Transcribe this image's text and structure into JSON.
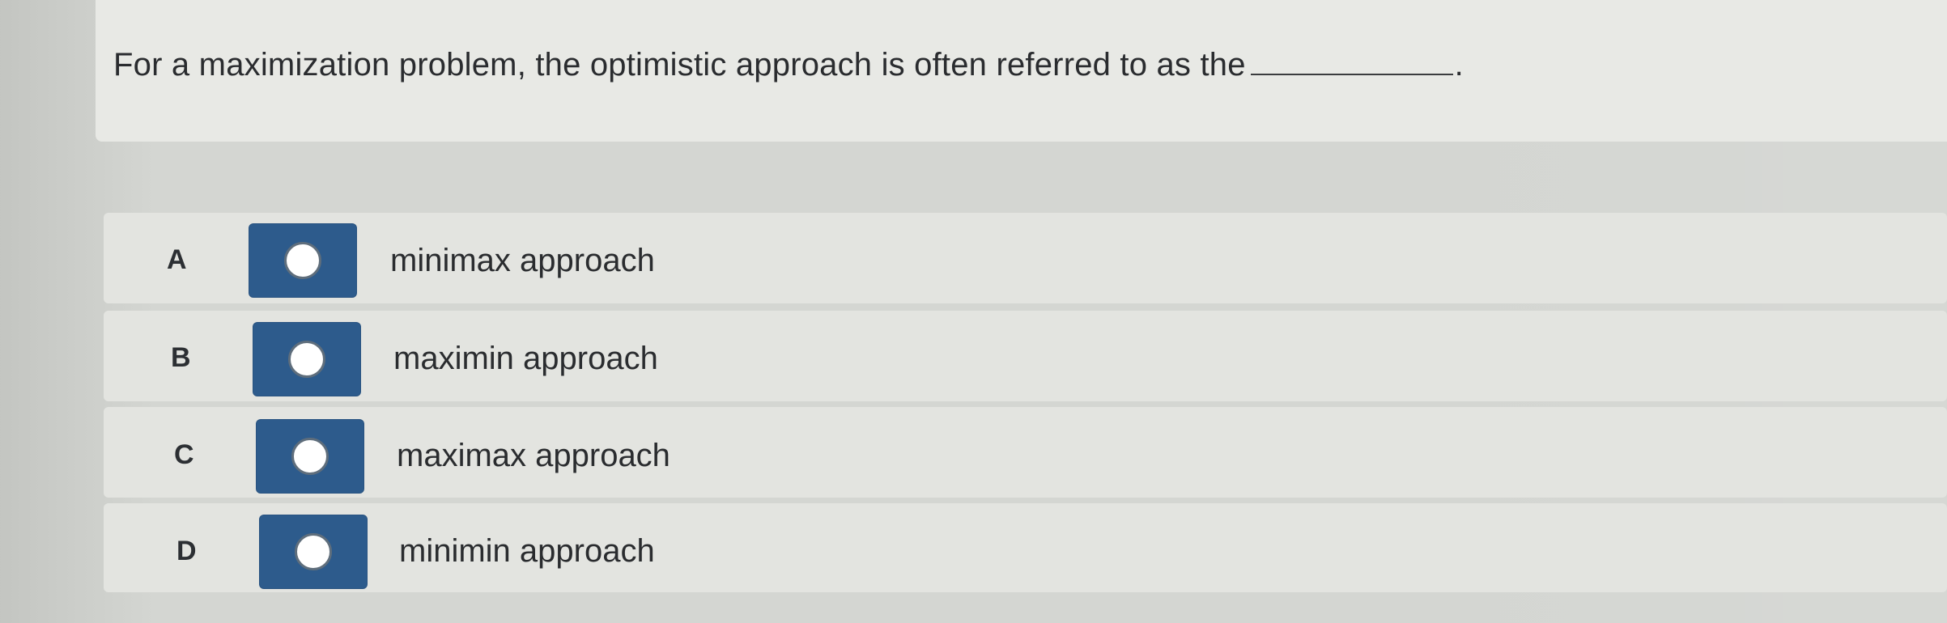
{
  "question": {
    "text_before_blank": "For a maximization problem, the optimistic approach is often referred to as the",
    "text_after_blank": "."
  },
  "options": [
    {
      "letter": "A",
      "label": "minimax approach",
      "icon": "radio-unselected-icon"
    },
    {
      "letter": "B",
      "label": "maximin approach",
      "icon": "radio-unselected-icon"
    },
    {
      "letter": "C",
      "label": "maximax approach",
      "icon": "radio-unselected-icon"
    },
    {
      "letter": "D",
      "label": "minimin approach",
      "icon": "radio-unselected-icon"
    }
  ],
  "colors": {
    "radio_box": "#2d5b8c",
    "radio_circle": "#ffffff",
    "card_background": "#e8e9e5",
    "page_background": "#d4d6d2"
  }
}
